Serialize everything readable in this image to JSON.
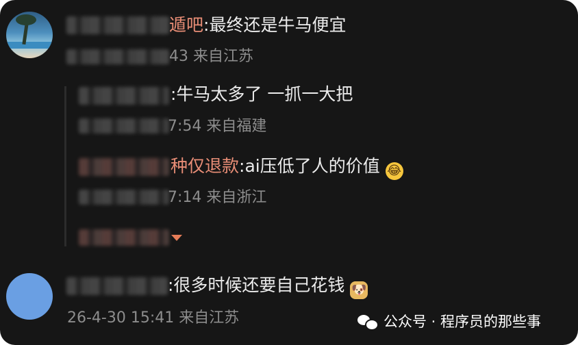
{
  "comments": [
    {
      "name_suffix": "遁吧",
      "separator": ":",
      "content": "最终还是牛马便宜",
      "time": "43",
      "location": "来自江苏"
    },
    {
      "content": ":牛马太多了 一抓一大把",
      "time": "7:54",
      "location": "来自福建"
    },
    {
      "name_suffix": "种仅退款",
      "content": ":ai压低了人的价值",
      "emoji": "😂",
      "time": "7:14",
      "location": "来自浙江"
    },
    {
      "content": ":很多时候还要自己花钱",
      "emoji": "🐶",
      "time": "26-4-30 15:41",
      "location": "来自江苏"
    }
  ],
  "watermark": {
    "text": "公众号 · 程序员的那些事",
    "icon": "wechat-icon"
  },
  "colors": {
    "background": "#161616",
    "text": "#ececec",
    "meta": "#8d8d8d",
    "username_accent": "#e88d76",
    "expand_arrow": "#e57c58"
  }
}
